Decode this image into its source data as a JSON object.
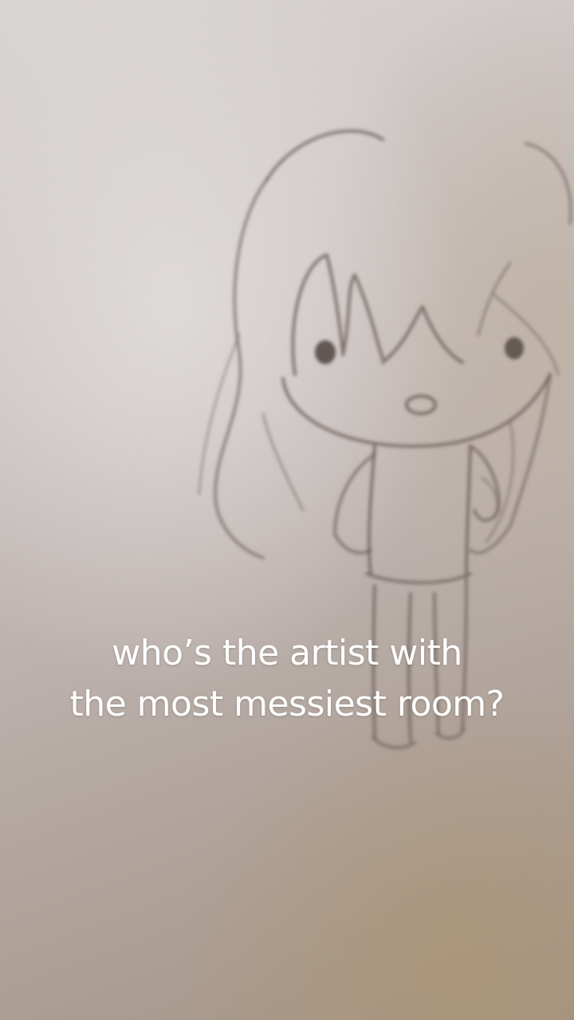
{
  "caption": {
    "line1": "who’s the artist with",
    "line2": "the most messiest room?"
  },
  "photo": {
    "subject_icon": "pencil-sketch-chibi-girl-icon",
    "paper_color": "#d2cccb",
    "pencil_color": "#6e625c"
  }
}
